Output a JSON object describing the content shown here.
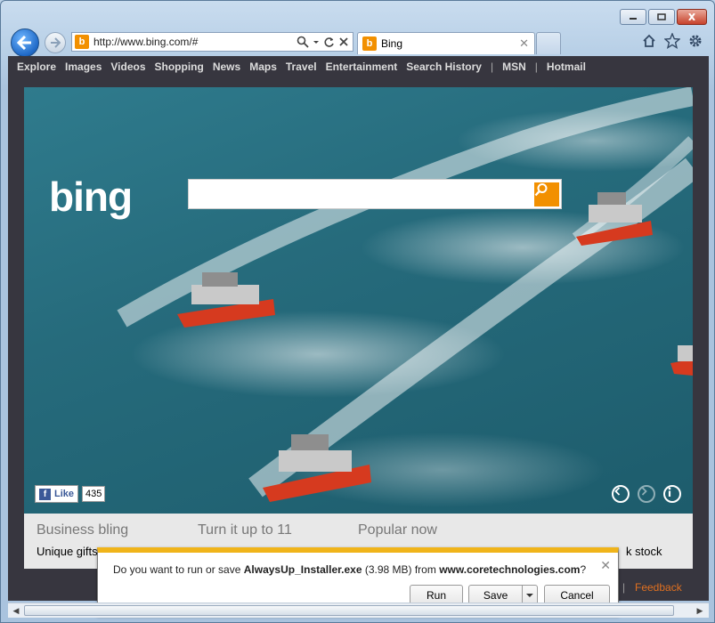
{
  "browser": {
    "url": "http://www.bing.com/#",
    "tab_title": "Bing",
    "favicon_letter": "b"
  },
  "bing_nav": {
    "items": [
      "Explore",
      "Images",
      "Videos",
      "Shopping",
      "News",
      "Maps",
      "Travel",
      "Entertainment",
      "Search History"
    ],
    "sep": "|",
    "msn": "MSN",
    "hotmail": "Hotmail"
  },
  "hero": {
    "logo": "bing",
    "like_label": "Like",
    "like_count": "435",
    "fb_glyph": "f"
  },
  "below": {
    "col1_head": "Business bling",
    "col1_sub": "Unique gifts",
    "col2_head": "Turn it up to 11",
    "col3_head": "Popular now",
    "col4_sub_fragment": "k stock",
    "feedback": "Feedback"
  },
  "download_bar": {
    "prefix": "Do you want to run or save ",
    "filename": "AlwaysUp_Installer.exe",
    "size": " (3.98 MB) from ",
    "source": "www.coretechnologies.com",
    "suffix": "?",
    "run_label": "Run",
    "save_label": "Save",
    "cancel_label": "Cancel"
  },
  "colors": {
    "bing_orange": "#f29000",
    "download_accent": "#f0b41a"
  }
}
